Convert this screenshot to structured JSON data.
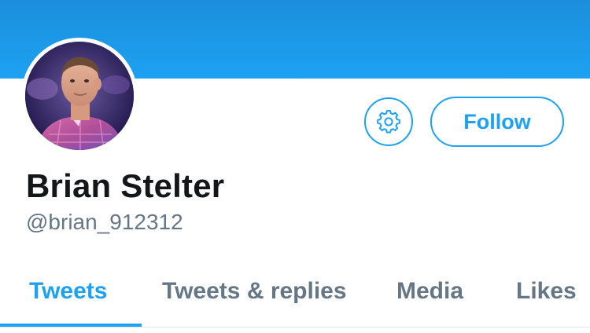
{
  "profile": {
    "display_name": "Brian Stelter",
    "handle": "@brian_912312"
  },
  "actions": {
    "settings_icon": "gear-icon",
    "follow_label": "Follow"
  },
  "tabs": [
    {
      "label": "Tweets",
      "active": true
    },
    {
      "label": "Tweets & replies",
      "active": false
    },
    {
      "label": "Media",
      "active": false
    },
    {
      "label": "Likes",
      "active": false
    }
  ],
  "colors": {
    "accent": "#1da1f2",
    "banner": "#1c8fdc",
    "name": "#14171a",
    "secondary_text": "#657786",
    "divider": "#e1e8ed"
  }
}
